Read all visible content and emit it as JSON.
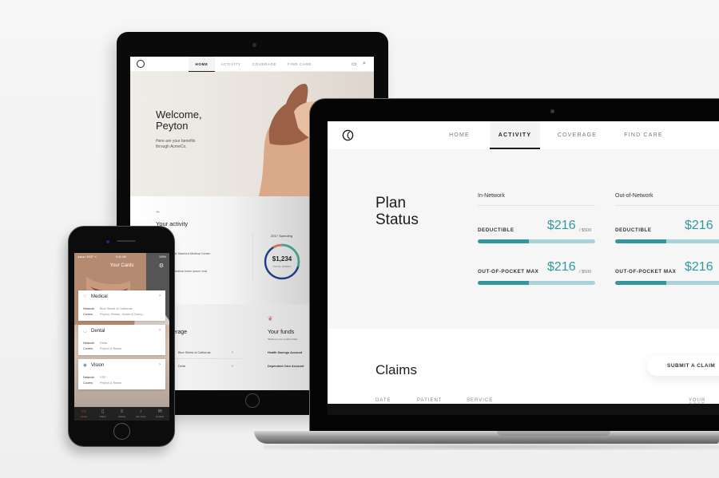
{
  "tablet": {
    "nav": {
      "tabs": [
        {
          "label": "HOME",
          "active": true
        },
        {
          "label": "ACTIVITY",
          "active": false
        },
        {
          "label": "COVERAGE",
          "active": false
        },
        {
          "label": "FIND CARE",
          "active": false
        }
      ],
      "icons": [
        "chat-icon",
        "search-icon"
      ]
    },
    "hero": {
      "title_line1": "Welcome,",
      "title_line2": "Peyton",
      "subtitle_line1": "Here are your benefits",
      "subtitle_line2": "through AcmeCo."
    },
    "activity": {
      "title": "Your activity",
      "items": [
        "...ive Visit at Stanford Medical Center",
        "...at One Medical lorem ipsum erat"
      ],
      "spending": {
        "label": "2017 Spending",
        "value": "$1,234",
        "caption": "TOTAL SPENT"
      }
    },
    "coverage": {
      "title": "...overage",
      "rows": [
        {
          "label": "Blue Shield of California"
        },
        {
          "label": "Delta"
        }
      ]
    },
    "funds": {
      "title": "Your funds",
      "subtitle": "*Balances are updated daily",
      "rows": [
        {
          "label": "Health Savings Account"
        },
        {
          "label": "Dependent Care Account"
        }
      ]
    }
  },
  "laptop": {
    "nav": {
      "tabs": [
        {
          "label": "HOME",
          "active": false
        },
        {
          "label": "ACTIVITY",
          "active": true
        },
        {
          "label": "COVERAGE",
          "active": false
        },
        {
          "label": "FIND CARE",
          "active": false
        }
      ]
    },
    "plan_status": {
      "title_line1": "Plan",
      "title_line2": "Status",
      "columns": [
        {
          "header": "In-Network",
          "metrics": [
            {
              "label": "DEDUCTIBLE",
              "value": "$216",
              "max": "/ $500",
              "progress": 0.432
            },
            {
              "label": "OUT-OF-POCKET MAX",
              "value": "$216",
              "max": "/ $500",
              "progress": 0.432
            }
          ]
        },
        {
          "header": "Out-of-Network",
          "metrics": [
            {
              "label": "DEDUCTIBLE",
              "value": "$216",
              "max": "",
              "progress": 0.432
            },
            {
              "label": "OUT-OF-POCKET MAX",
              "value": "$216",
              "max": "",
              "progress": 0.432
            }
          ]
        }
      ]
    },
    "claims": {
      "title": "Claims",
      "submit_label": "SUBMIT A CLAIM",
      "columns": [
        "DATE",
        "PATIENT",
        "SERVICE",
        "YOUR COST"
      ]
    }
  },
  "phone": {
    "status": {
      "carrier": "●●●●○ AT&T ᯤ",
      "time": "9:41 AM",
      "battery": "100%"
    },
    "title": "Your Cards",
    "cards": [
      {
        "icon": "heart-icon",
        "name": "Medical",
        "network_label": "Network",
        "network": "Blue Shield of California",
        "covers_label": "Covers",
        "covers": "Peyton, Reese, Jordan & Darcy..."
      },
      {
        "icon": "tooth-icon",
        "name": "Dental",
        "network_label": "Network",
        "network": "Delta",
        "covers_label": "Covers",
        "covers": "Peyton & Reese"
      },
      {
        "icon": "eye-icon",
        "name": "Vision",
        "network_label": "Network",
        "network": "VSP",
        "covers_label": "Covers",
        "covers": "Peyton & Reese"
      }
    ],
    "tabbar": [
      {
        "label": "Cards",
        "icon": "card-icon",
        "active": true
      },
      {
        "label": "Plans",
        "icon": "document-icon",
        "active": false
      },
      {
        "label": "Activity",
        "icon": "list-icon",
        "active": false
      },
      {
        "label": "Get Care",
        "icon": "stethoscope-icon",
        "active": false
      },
      {
        "label": "Contact",
        "icon": "mail-icon",
        "active": false
      }
    ]
  },
  "colors": {
    "accent_teal": "#2e9aa0",
    "bar_fill": "#35969c",
    "bar_track": "#a9d3d8",
    "accent_coral": "#e26b5a",
    "ring_blue": "#1d3f8a",
    "ring_green": "#3aa58a"
  }
}
